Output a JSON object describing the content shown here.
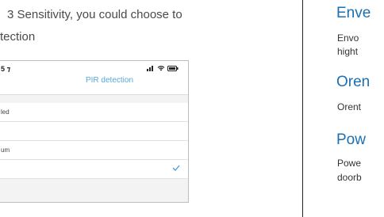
{
  "doc": {
    "line1": "3 Sensitivity, you could choose to",
    "line2": "tection"
  },
  "phone": {
    "time": "5 ⁊",
    "nav_title": "PIR detection",
    "options": [
      {
        "label": "led",
        "selected": false
      },
      {
        "label": "",
        "selected": false
      },
      {
        "label": "um",
        "selected": false
      },
      {
        "label": "",
        "selected": true
      }
    ]
  },
  "right": {
    "h1": "Enve",
    "p1a": "Envo",
    "p1b": "hight",
    "h2": "Oren",
    "p2": "Orent",
    "h3": "Pow",
    "p3a": "Powe",
    "p3b": "doorb"
  },
  "colors": {
    "heading": "#1c6fb0",
    "nav_title": "#5aa6d8",
    "check": "#4a9fd8"
  }
}
